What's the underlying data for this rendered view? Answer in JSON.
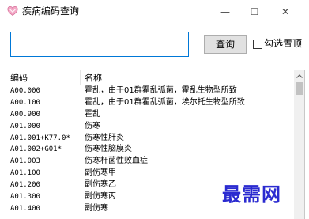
{
  "window": {
    "title": "疾病编码查询",
    "icon": "app-heart-icon",
    "minimize_glyph": "—",
    "maximize_glyph": "☐",
    "close_glyph": "✕"
  },
  "search": {
    "value": "",
    "placeholder": "",
    "button_label": "查询"
  },
  "pin": {
    "label": "勾选置顶",
    "checked": false
  },
  "table": {
    "headers": [
      "编码",
      "名称"
    ],
    "rows": [
      {
        "code": "A00.000",
        "name": "霍乱，由于01群霍乱弧菌，霍乱生物型所致"
      },
      {
        "code": "A00.100",
        "name": "霍乱，由于01群霍乱弧菌，埃尔托生物型所致"
      },
      {
        "code": "A00.900",
        "name": "霍乱"
      },
      {
        "code": "A01.000",
        "name": "伤寒"
      },
      {
        "code": "A01.001+K77.0*",
        "name": "伤寒性肝炎"
      },
      {
        "code": "A01.002+G01*",
        "name": "伤寒性脑膜炎"
      },
      {
        "code": "A01.003",
        "name": "伤寒杆菌性败血症"
      },
      {
        "code": "A01.100",
        "name": "副伤寒甲"
      },
      {
        "code": "A01.200",
        "name": "副伤寒乙"
      },
      {
        "code": "A01.300",
        "name": "副伤寒丙"
      },
      {
        "code": "A01.400",
        "name": "副伤寒"
      }
    ]
  },
  "watermark": "最需网",
  "colors": {
    "accent": "#0078d7",
    "watermark": "#2b2bd0"
  }
}
